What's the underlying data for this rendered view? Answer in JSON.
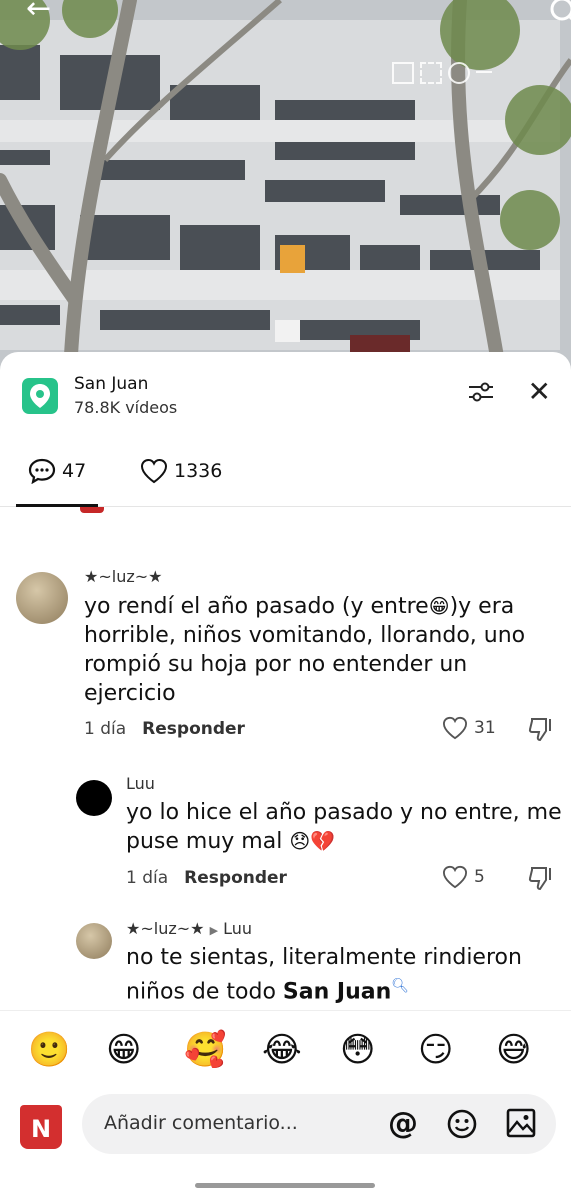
{
  "location": {
    "name": "San Juan",
    "videos": "78.8K vídeos"
  },
  "tabs": {
    "comments_count": "47",
    "likes_count": "1336"
  },
  "comments": [
    {
      "user": "★~luz~★",
      "text_before": "yo rendí el año pasado (y entre",
      "text_emoji": "😁",
      "text_after": ")y era horrible, niños vomitando, llorando, uno rompió su hoja por no entender un ejercicio",
      "time": "1 día",
      "reply_label": "Responder",
      "likes": "31"
    },
    {
      "user": "Luu",
      "text": "yo lo hice el año pasado y no entre, me puse muy mal",
      "emojis": "😞💔",
      "time": "1 día",
      "reply_label": "Responder",
      "likes": "5"
    },
    {
      "user": "★~luz~★",
      "reply_to": "Luu",
      "text": "no te sientas, literalmente rindieron niños de todo ",
      "link_text": "San Juan"
    }
  ],
  "emoji_bar": [
    "🙂",
    "😁",
    "🥰",
    "😂",
    "😳",
    "😏",
    "😅"
  ],
  "input": {
    "placeholder": "Añadir comentario...",
    "at_symbol": "@"
  },
  "badge": {
    "letter": "N"
  },
  "colors": {
    "pin": "#27c38a",
    "badge": "#d32f2f",
    "link": "#3b7bd8"
  },
  "icons": [
    "back-arrow-icon",
    "search-icon",
    "location-pin-icon",
    "filter-icon",
    "close-icon",
    "comment-icon",
    "heart-icon",
    "dislike-icon",
    "smile-icon",
    "image-icon"
  ]
}
